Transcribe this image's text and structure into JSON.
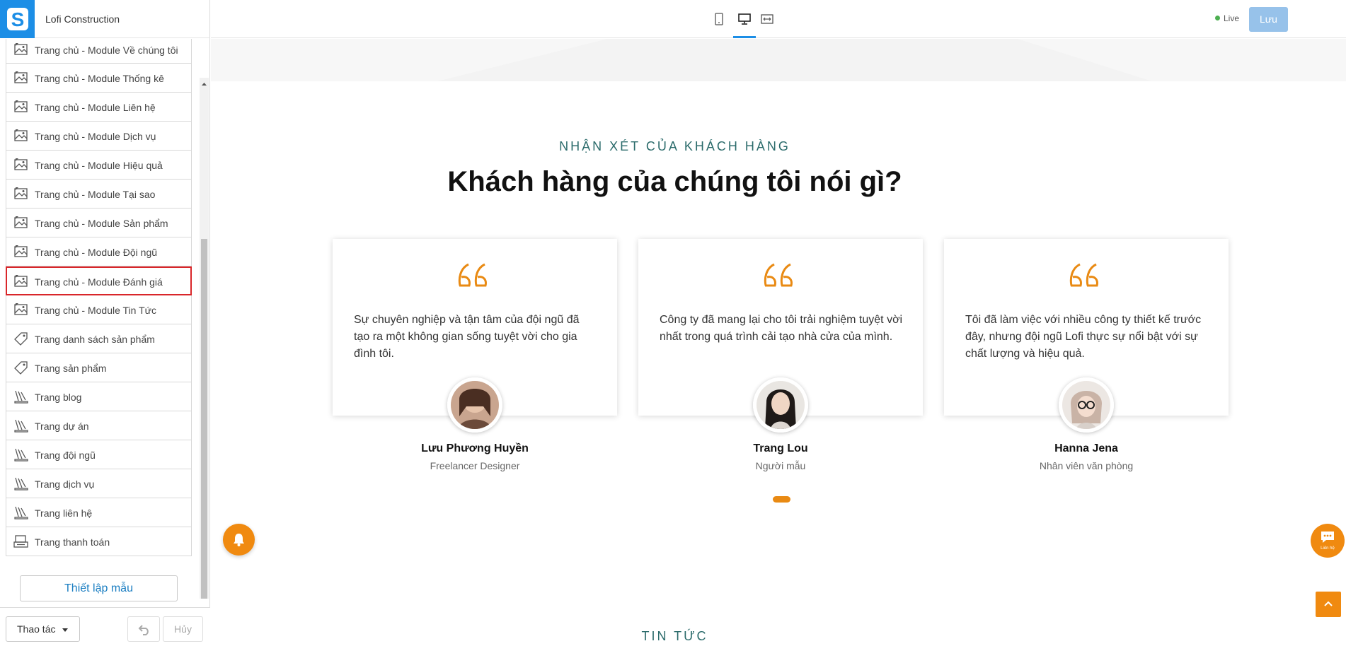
{
  "app": {
    "site_name": "Lofi Construction",
    "logo_icon": "s-logo-icon",
    "accent": "#1c8ee6"
  },
  "sidebar": {
    "items": [
      {
        "label": "Trang chủ - Module Về chúng tôi",
        "icon": "image-icon"
      },
      {
        "label": "Trang chủ - Module Thống kê",
        "icon": "image-icon"
      },
      {
        "label": "Trang chủ - Module Liên hệ",
        "icon": "image-icon"
      },
      {
        "label": "Trang chủ - Module Dịch vụ",
        "icon": "image-icon"
      },
      {
        "label": "Trang chủ - Module Hiệu quả",
        "icon": "image-icon"
      },
      {
        "label": "Trang chủ - Module Tại sao",
        "icon": "image-icon"
      },
      {
        "label": "Trang chủ - Module Sản phẩm",
        "icon": "image-icon"
      },
      {
        "label": "Trang chủ - Module Đội ngũ",
        "icon": "image-icon"
      },
      {
        "label": "Trang chủ - Module Đánh giá",
        "icon": "image-icon",
        "selected": true
      },
      {
        "label": "Trang chủ - Module Tin Tức",
        "icon": "image-icon"
      },
      {
        "label": "Trang danh sách sản phẩm",
        "icon": "tag-icon"
      },
      {
        "label": "Trang sản phẩm",
        "icon": "tag-icon"
      },
      {
        "label": "Trang blog",
        "icon": "pages-icon"
      },
      {
        "label": "Trang dự án",
        "icon": "pages-icon"
      },
      {
        "label": "Trang đội ngũ",
        "icon": "pages-icon"
      },
      {
        "label": "Trang dịch vụ",
        "icon": "pages-icon"
      },
      {
        "label": "Trang liên hệ",
        "icon": "pages-icon"
      },
      {
        "label": "Trang thanh toán",
        "icon": "checkout-icon"
      }
    ],
    "preset_button": "Thiết lập mẫu",
    "actions_button": "Thao tác",
    "cancel_button": "Hủy"
  },
  "topbar": {
    "devices": [
      "mobile-icon",
      "desktop-icon",
      "fullwidth-icon"
    ],
    "active_device": "desktop-icon",
    "status": "Live",
    "status_color": "#4caf50",
    "save_button": "Lưu"
  },
  "testimonials": {
    "eyebrow": "NHẬN XÉT CỦA KHÁCH HÀNG",
    "heading": "Khách hàng của chúng tôi nói gì?",
    "quote_color": "#e98a13",
    "cards": [
      {
        "text": "Sự chuyên nghiệp và tận tâm của đội ngũ đã tạo ra một không gian sống tuyệt vời cho gia đình tôi.",
        "name": "Lưu Phương Huyền",
        "role": "Freelancer Designer"
      },
      {
        "text": "Công ty đã mang lại cho tôi trải nghiệm tuyệt vời nhất trong quá trình cải tạo nhà cửa của mình.",
        "name": "Trang Lou",
        "role": "Người mẫu"
      },
      {
        "text": "Tôi đã làm việc với nhiều công ty thiết kế trước đây, nhưng đội ngũ Lofi thực sự nổi bật với sự chất lượng và hiệu quả.",
        "name": "Hanna Jena",
        "role": "Nhân viên văn phòng"
      }
    ]
  },
  "news": {
    "title": "TIN TỨC"
  },
  "widgets": {
    "chat_label": "Liên hệ",
    "notification_icon": "bell-icon",
    "back_to_top_icon": "chevron-up-icon"
  }
}
